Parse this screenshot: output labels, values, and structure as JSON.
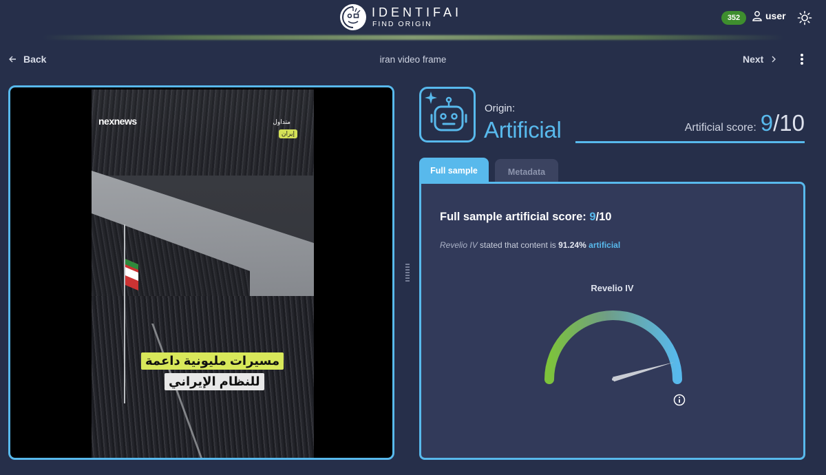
{
  "header": {
    "logo_name": "IDENTIFAI",
    "logo_subtitle": "FIND ORIGIN",
    "credits": "352",
    "user_label": "user"
  },
  "toolbar": {
    "back_label": "Back",
    "title": "iran video frame",
    "next_label": "Next"
  },
  "media": {
    "brand": "nexnews",
    "tag": "متداول",
    "location": "إيران",
    "caption_line1": "مسيرات مليونية داعمة",
    "caption_line2": "للنظام الإيراني"
  },
  "result": {
    "origin_label": "Origin:",
    "origin_value": "Artificial",
    "score_label": "Artificial score:",
    "score": "9",
    "score_max": "/10"
  },
  "tabs": [
    {
      "label": "Full sample",
      "active": true
    },
    {
      "label": "Metadata",
      "active": false
    }
  ],
  "full_sample": {
    "title_prefix": "Full sample artificial score: ",
    "score": "9",
    "score_max": "/10",
    "model": "Revelio IV",
    "statement_mid": " stated that content is ",
    "percent": "91.24%",
    "kind": "artificial",
    "gauge_title": "Revelio IV",
    "gauge_fraction": 0.9124
  },
  "colors": {
    "accent": "#58b9ec",
    "background": "#262f4a",
    "panel": "#323a5a",
    "credits_badge": "#3e8e2e"
  },
  "icons": {
    "back": "arrow-left-icon",
    "next": "chevron-right-icon",
    "menu": "kebab-menu-icon",
    "user": "user-icon",
    "theme": "sun-icon",
    "origin": "robot-icon",
    "info": "info-icon"
  }
}
